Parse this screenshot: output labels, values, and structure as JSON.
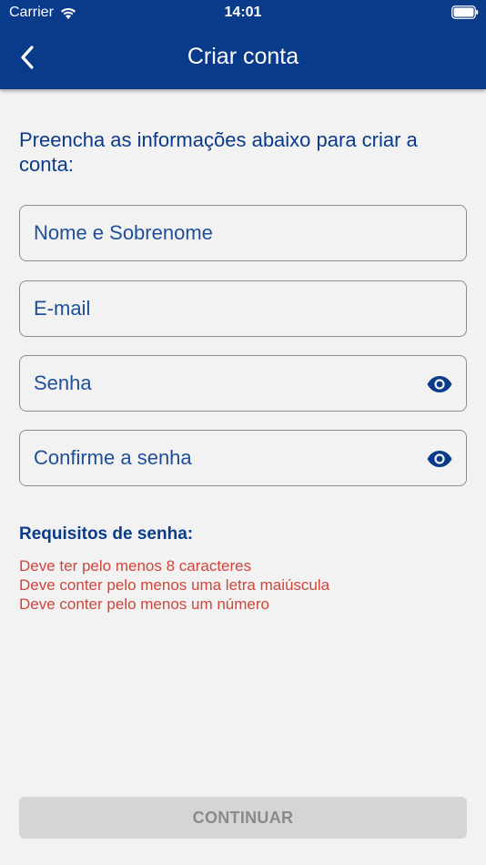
{
  "status_bar": {
    "carrier": "Carrier",
    "time": "14:01"
  },
  "nav": {
    "title": "Criar conta",
    "back_icon": "chevron-left-icon"
  },
  "form": {
    "intro": "Preencha as informações abaixo para criar a conta:",
    "fields": [
      {
        "placeholder": "Nome e Sobrenome",
        "value": "",
        "type": "text"
      },
      {
        "placeholder": "E-mail",
        "value": "",
        "type": "email"
      },
      {
        "placeholder": "Senha",
        "value": "",
        "type": "password",
        "icon": "eye-icon"
      },
      {
        "placeholder": "Confirme a senha",
        "value": "",
        "type": "password",
        "icon": "eye-icon"
      }
    ]
  },
  "requirements": {
    "title": "Requisitos de senha:",
    "items": [
      "Deve ter pelo menos 8 caracteres",
      "Deve conter pelo menos uma letra maiúscula",
      "Deve conter pelo menos um número"
    ]
  },
  "continue_label": "CONTINUAR",
  "colors": {
    "primary": "#0a3a8a",
    "error": "#d0453a",
    "background": "#f2f2f2",
    "disabled_button": "#d5d5d5",
    "disabled_text": "#8a8a8a"
  }
}
